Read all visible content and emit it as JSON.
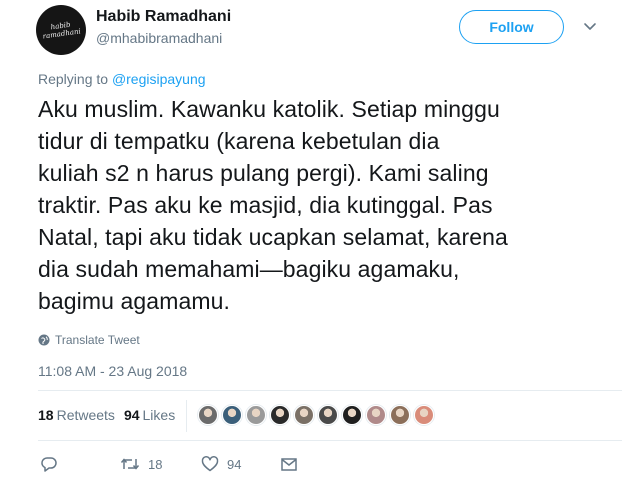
{
  "author": {
    "name": "Habib Ramadhani",
    "handle": "@mhabibramadhani",
    "avatar_text": "habib ramadhani"
  },
  "follow_label": "Follow",
  "reply_context": {
    "prefix": "Replying to",
    "mention": "@regisipayung"
  },
  "tweet_text": "Aku muslim. Kawanku katolik. Setiap minggu\ntidur di tempatku (karena kebetulan dia\nkuliah s2 n harus pulang pergi). Kami saling\ntraktir. Pas aku ke masjid, dia kutinggal. Pas\nNatal, tapi aku tidak ucapkan selamat, karena\ndia sudah memahami—bagiku agamaku,\nbagimu agamamu.",
  "translate_label": "Translate Tweet",
  "timestamp": "11:08 AM - 23 Aug 2018",
  "stats": {
    "retweets_count": "18",
    "retweets_label": "Retweets",
    "likes_count": "94",
    "likes_label": "Likes"
  },
  "liker_avatar_colors": [
    "#6b6b6b",
    "#3b5f7a",
    "#9a9a9a",
    "#2a2a2a",
    "#7a7066",
    "#4a4a4a",
    "#1f1f1f",
    "#b08a8a",
    "#8c6f5a",
    "#d98c7a"
  ],
  "actions": {
    "reply_icon": "reply-icon",
    "retweet_icon": "retweet-icon",
    "retweet_count": "18",
    "like_icon": "heart-icon",
    "like_count": "94",
    "dm_icon": "envelope-icon"
  },
  "colors": {
    "accent": "#1da1f2",
    "secondary_text": "#657786",
    "primary_text": "#14171a",
    "divider": "#e6ecf0"
  }
}
